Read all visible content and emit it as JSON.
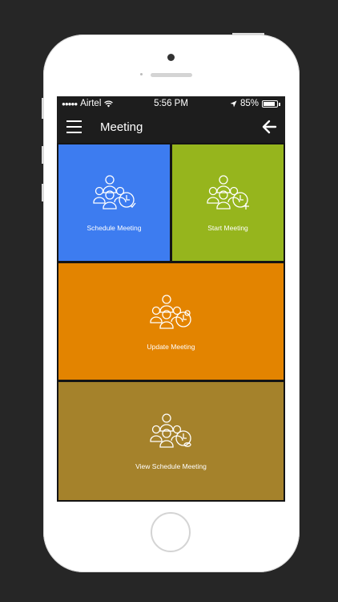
{
  "status_bar": {
    "carrier": "Airtel",
    "time": "5:56 PM",
    "battery_percent": "85%",
    "battery_level": 0.85
  },
  "nav": {
    "title": "Meeting"
  },
  "tiles": [
    {
      "label": "Schedule Meeting",
      "color": "#3d7cf0"
    },
    {
      "label": "Start Meeting",
      "color": "#96b51d"
    },
    {
      "label": "Update Meeting",
      "color": "#e38400"
    },
    {
      "label": "View Schedule Meeting",
      "color": "#a5822b"
    }
  ],
  "icons": {
    "menu": "hamburger-icon",
    "back": "arrow-left-icon",
    "meeting": "people-clock-icon"
  }
}
